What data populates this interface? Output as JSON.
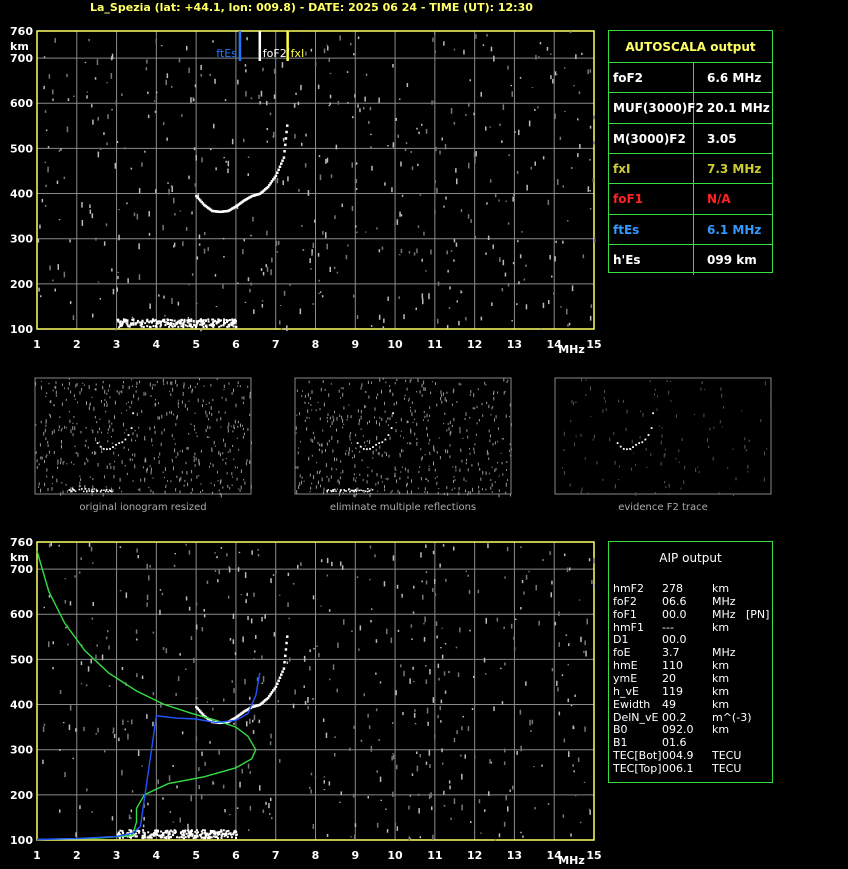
{
  "header": {
    "title": "La_Spezia (lat: +44.1, lon: 009.8) - DATE: 2025 06 24 - TIME (UT): 12:30"
  },
  "colors": {
    "grid": "#8a8a8a",
    "axis": "#ffff66",
    "green": "#33dd44",
    "blue": "#2255ff",
    "red": "#ff2222",
    "foEs_blue": "#3399ff",
    "fxI_yellow": "#cccc33"
  },
  "top_chart": {
    "y_unit": "km",
    "x_unit": "MHz",
    "markers": [
      {
        "label": "ftEs",
        "color": "#2277ff",
        "freq": 6.1
      },
      {
        "label": "foF2",
        "color": "#ffffff",
        "freq": 6.6
      },
      {
        "label": "fxI",
        "color": "#ffff44",
        "freq": 7.3
      }
    ]
  },
  "thumbnails": [
    {
      "caption": "original ionogram resized"
    },
    {
      "caption": "eliminate multiple reflections"
    },
    {
      "caption": "evidence F2 trace"
    }
  ],
  "autoscala": {
    "title": "AUTOSCALA output",
    "rows": [
      {
        "label": "foF2",
        "value": "6.6 MHz",
        "color": "#ffffff"
      },
      {
        "label": "MUF(3000)F2",
        "value": "20.1 MHz",
        "color": "#ffffff"
      },
      {
        "label": "M(3000)F2",
        "value": "3.05",
        "color": "#ffffff"
      },
      {
        "label": "fxI",
        "value": "7.3 MHz",
        "color": "#cccc33"
      },
      {
        "label": "foF1",
        "value": "N/A",
        "color": "#ff2222"
      },
      {
        "label": "ftEs",
        "value": "6.1 MHz",
        "color": "#3399ff"
      },
      {
        "label": "h'Es",
        "value": "099     km",
        "color": "#ffffff"
      }
    ]
  },
  "aip": {
    "title": "AIP output",
    "rows": [
      {
        "name": "hmF2",
        "val": "278",
        "unit": "km",
        "extra": ""
      },
      {
        "name": "foF2",
        "val": "06.6",
        "unit": "MHz",
        "extra": ""
      },
      {
        "name": "foF1",
        "val": "00.0",
        "unit": "MHz",
        "extra": "[PN]"
      },
      {
        "name": "hmF1",
        "val": "---",
        "unit": "km",
        "extra": ""
      },
      {
        "name": "D1",
        "val": "00.0",
        "unit": "",
        "extra": ""
      },
      {
        "name": "foE",
        "val": "3.7",
        "unit": "MHz",
        "extra": ""
      },
      {
        "name": "hmE",
        "val": "110",
        "unit": "km",
        "extra": ""
      },
      {
        "name": "ymE",
        "val": "20",
        "unit": "km",
        "extra": ""
      },
      {
        "name": "h_vE",
        "val": "119",
        "unit": "km",
        "extra": ""
      },
      {
        "name": "Ewidth",
        "val": "49",
        "unit": "km",
        "extra": ""
      },
      {
        "name": "DelN_vE",
        "val": "00.2",
        "unit": "m^(-3)",
        "extra": ""
      },
      {
        "name": "B0",
        "val": "092.0",
        "unit": "km",
        "extra": ""
      },
      {
        "name": "B1",
        "val": "01.6",
        "unit": "",
        "extra": ""
      },
      {
        "name": "TEC[Bot]",
        "val": "004.9",
        "unit": "TECU",
        "extra": ""
      },
      {
        "name": "TEC[Top]",
        "val": "006.1",
        "unit": "TECU",
        "extra": ""
      }
    ]
  },
  "chart_data": [
    {
      "type": "scatter",
      "title": "",
      "xlabel": "MHz",
      "ylabel": "km",
      "xlim": [
        1,
        15
      ],
      "ylim": [
        100,
        760
      ],
      "x_ticks": [
        1,
        2,
        3,
        4,
        5,
        6,
        7,
        8,
        9,
        10,
        11,
        12,
        13,
        14,
        15
      ],
      "y_ticks": [
        100,
        200,
        300,
        400,
        500,
        600,
        700,
        760
      ],
      "series": [
        {
          "values_x": [
            5.0,
            5.2,
            5.4,
            5.6,
            5.8,
            6.0,
            6.2,
            6.4,
            6.6,
            6.8,
            7.0,
            7.2,
            7.3
          ],
          "values_y": [
            395,
            375,
            362,
            360,
            362,
            372,
            385,
            395,
            400,
            415,
            440,
            480,
            565
          ]
        }
      ]
    },
    {
      "type": "line",
      "title": "",
      "xlabel": "MHz",
      "ylabel": "km",
      "xlim": [
        1,
        15
      ],
      "ylim": [
        100,
        760
      ],
      "x_ticks": [
        1,
        2,
        3,
        4,
        5,
        6,
        7,
        8,
        9,
        10,
        11,
        12,
        13,
        14,
        15
      ],
      "y_ticks": [
        100,
        200,
        300,
        400,
        500,
        600,
        700,
        760
      ],
      "series": [
        {
          "values_x": [
            1.0,
            1.3,
            1.7,
            2.2,
            2.8,
            3.5,
            4.2,
            4.9,
            5.5,
            6.0,
            6.3,
            6.5,
            6.4,
            6.0,
            5.2,
            4.3,
            3.7,
            3.5,
            3.5,
            3.4,
            2.5,
            1.5,
            1.0
          ],
          "values_y": [
            740,
            650,
            580,
            520,
            470,
            430,
            400,
            380,
            365,
            350,
            330,
            300,
            280,
            260,
            240,
            225,
            200,
            170,
            140,
            110,
            104,
            102,
            101
          ]
        },
        {
          "values_x": [
            1.0,
            2.0,
            3.0,
            3.4,
            3.6,
            4.0,
            4.5,
            5.0,
            5.5,
            6.0,
            6.3,
            6.5,
            6.6
          ],
          "values_y": [
            101,
            103,
            108,
            115,
            130,
            375,
            370,
            368,
            360,
            365,
            380,
            420,
            470
          ]
        }
      ]
    }
  ]
}
